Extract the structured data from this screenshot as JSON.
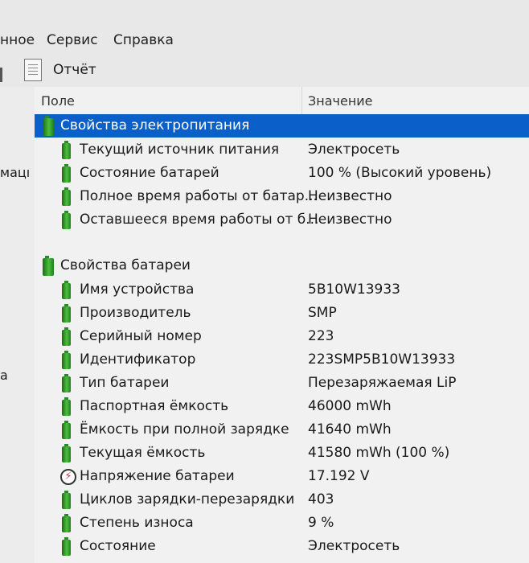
{
  "menu": [
    "нное",
    "Сервис",
    "Справка"
  ],
  "toolbar": {
    "report_label": "Отчёт"
  },
  "left_pane": {
    "fragments": [
      "мацı",
      "а"
    ]
  },
  "columns": {
    "field": "Поле",
    "value": "Значение"
  },
  "rows": [
    {
      "type": "group",
      "field": "Свойства электропитания",
      "value": "",
      "icon": "battery-icon",
      "selected": true
    },
    {
      "type": "item",
      "field": "Текущий источник питания",
      "value": "Электросеть",
      "icon": "battery-icon"
    },
    {
      "type": "item",
      "field": "Состояние батарей",
      "value": "100 % (Высокий уровень)",
      "icon": "battery-icon"
    },
    {
      "type": "item",
      "field": "Полное время работы от батар...",
      "value": "Неизвестно",
      "icon": "battery-icon"
    },
    {
      "type": "item",
      "field": "Оставшееся время работы от б...",
      "value": "Неизвестно",
      "icon": "battery-icon"
    },
    {
      "type": "group",
      "field": "Свойства батареи",
      "value": "",
      "icon": "battery-icon"
    },
    {
      "type": "item",
      "field": "Имя устройства",
      "value": "5B10W13933",
      "icon": "battery-icon"
    },
    {
      "type": "item",
      "field": "Производитель",
      "value": "SMP",
      "icon": "battery-icon"
    },
    {
      "type": "item",
      "field": "Серийный номер",
      "value": "223",
      "icon": "battery-icon"
    },
    {
      "type": "item",
      "field": "Идентификатор",
      "value": "223SMP5B10W13933",
      "icon": "battery-icon"
    },
    {
      "type": "item",
      "field": "Тип батареи",
      "value": "Перезаряжаемая LiP",
      "icon": "battery-icon"
    },
    {
      "type": "item",
      "field": "Паспортная ёмкость",
      "value": "46000 mWh",
      "icon": "battery-icon"
    },
    {
      "type": "item",
      "field": "Ёмкость при полной зарядке",
      "value": "41640 mWh",
      "icon": "battery-icon"
    },
    {
      "type": "item",
      "field": "Текущая ёмкость",
      "value": "41580 mWh  (100 %)",
      "icon": "battery-icon"
    },
    {
      "type": "item",
      "field": "Напряжение батареи",
      "value": "17.192 V",
      "icon": "voltage-icon"
    },
    {
      "type": "item",
      "field": "Циклов зарядки-перезарядки",
      "value": "403",
      "icon": "battery-icon"
    },
    {
      "type": "item",
      "field": "Степень износа",
      "value": "9 %",
      "icon": "battery-icon"
    },
    {
      "type": "item",
      "field": "Состояние",
      "value": "Электросеть",
      "icon": "battery-icon"
    }
  ],
  "colors": {
    "selection": "#0a5fc8",
    "battery_green": "#3aa52e",
    "background": "#f1f1f1"
  }
}
